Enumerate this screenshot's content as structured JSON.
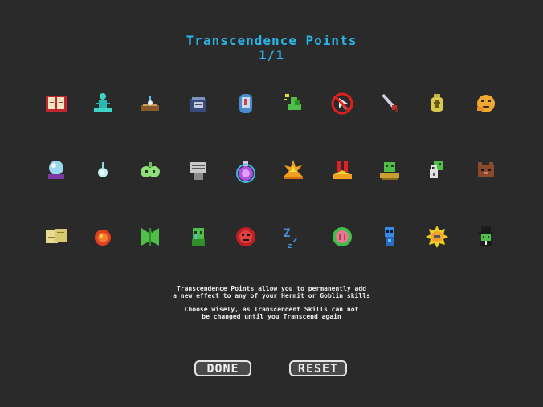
{
  "header": {
    "title": "Transcendence Points",
    "points": "1/1"
  },
  "skills": [
    {
      "row": 1,
      "col": 1,
      "icon": "spellbook-icon"
    },
    {
      "row": 1,
      "col": 2,
      "icon": "meditating-figure-icon"
    },
    {
      "row": 1,
      "col": 3,
      "icon": "nest-icon"
    },
    {
      "row": 1,
      "col": 4,
      "icon": "cauldron-icon"
    },
    {
      "row": 1,
      "col": 5,
      "icon": "tombstone-icon"
    },
    {
      "row": 1,
      "col": 6,
      "icon": "strong-arm-icon"
    },
    {
      "row": 1,
      "col": 7,
      "icon": "no-cursor-icon"
    },
    {
      "row": 1,
      "col": 8,
      "icon": "dagger-icon"
    },
    {
      "row": 1,
      "col": 9,
      "icon": "money-bag-icon"
    },
    {
      "row": 1,
      "col": 10,
      "icon": "thinking-face-icon"
    },
    {
      "row": 2,
      "col": 1,
      "icon": "crystal-ball-icon"
    },
    {
      "row": 2,
      "col": 2,
      "icon": "wisp-icon"
    },
    {
      "row": 2,
      "col": 3,
      "icon": "slime-icon"
    },
    {
      "row": 2,
      "col": 4,
      "icon": "machine-icon"
    },
    {
      "row": 2,
      "col": 5,
      "icon": "potion-icon"
    },
    {
      "row": 2,
      "col": 6,
      "icon": "explosion-icon"
    },
    {
      "row": 2,
      "col": 7,
      "icon": "double-exclamation-icon"
    },
    {
      "row": 2,
      "col": 8,
      "icon": "goblin-explosion-icon"
    },
    {
      "row": 2,
      "col": 9,
      "icon": "locked-goblin-icon"
    },
    {
      "row": 2,
      "col": 10,
      "icon": "bear-icon"
    },
    {
      "row": 3,
      "col": 1,
      "icon": "scrolls-icon"
    },
    {
      "row": 3,
      "col": 2,
      "icon": "fireball-icon"
    },
    {
      "row": 3,
      "col": 3,
      "icon": "green-banner-icon"
    },
    {
      "row": 3,
      "col": 4,
      "icon": "weeping-goblin-icon"
    },
    {
      "row": 3,
      "col": 5,
      "icon": "red-orb-icon"
    },
    {
      "row": 3,
      "col": 6,
      "icon": "sleep-icon"
    },
    {
      "row": 3,
      "col": 7,
      "icon": "brain-icon"
    },
    {
      "row": 3,
      "col": 8,
      "icon": "blue-goblin-icon"
    },
    {
      "row": 3,
      "col": 9,
      "icon": "sun-face-icon"
    },
    {
      "row": 3,
      "col": 10,
      "icon": "top-hat-goblin-icon"
    }
  ],
  "description": {
    "line1": "Transcendence Points allow you to permanently add",
    "line2": "a new effect to any of your Hermit or Goblin skills",
    "line3": "Choose wisely, as Transcendent Skills can not",
    "line4": "be changed until you Transcend again"
  },
  "buttons": {
    "done_label": "DONE",
    "reset_label": "RESET"
  },
  "colors": {
    "accent": "#29b6e8",
    "background": "#2a2a2a",
    "text": "#f0f0f0"
  }
}
